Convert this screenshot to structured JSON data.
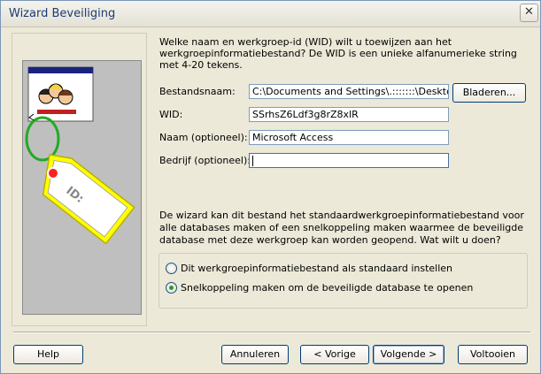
{
  "window": {
    "title": "Wizard Beveiliging",
    "close_glyph": "✕"
  },
  "intro": "Welke naam en werkgroep-id (WID) wilt u toewijzen aan het werkgroepinformatiebestand? De WID is een unieke alfanumerieke string met 4-20 tekens.",
  "illustration": {
    "tag_text": "ID:"
  },
  "form": {
    "filename": {
      "label": "Bestandsnaam:",
      "value": "C:\\Documents and Settings\\.:::::::\\Desktop\\"
    },
    "wid": {
      "label": "WID:",
      "value": "SSrhsZ6Ldf3g8rZ8xlR"
    },
    "name": {
      "label": "Naam (optioneel):",
      "value": "Microsoft Access"
    },
    "company": {
      "label": "Bedrijf (optioneel):",
      "value": ""
    }
  },
  "browse_button": "Bladeren...",
  "description": "De wizard kan dit bestand het standaardwerkgroepinformatiebestand voor alle databases maken of een snelkoppeling maken waarmee de beveiligde database met deze werkgroep kan worden geopend. Wat wilt u doen?",
  "options": [
    {
      "label": "Dit werkgroepinformatiebestand als standaard instellen",
      "checked": false
    },
    {
      "label": "Snelkoppeling maken om de beveiligde database te openen",
      "checked": true
    }
  ],
  "buttons": {
    "help": "Help",
    "cancel": "Annuleren",
    "back": "< Vorige",
    "next": "Volgende >",
    "finish": "Voltooien"
  },
  "colors": {
    "tag": "#ffff00",
    "ring": "#22aa22",
    "window_face": "#ece9d8",
    "title_text": "#1c3c75"
  }
}
